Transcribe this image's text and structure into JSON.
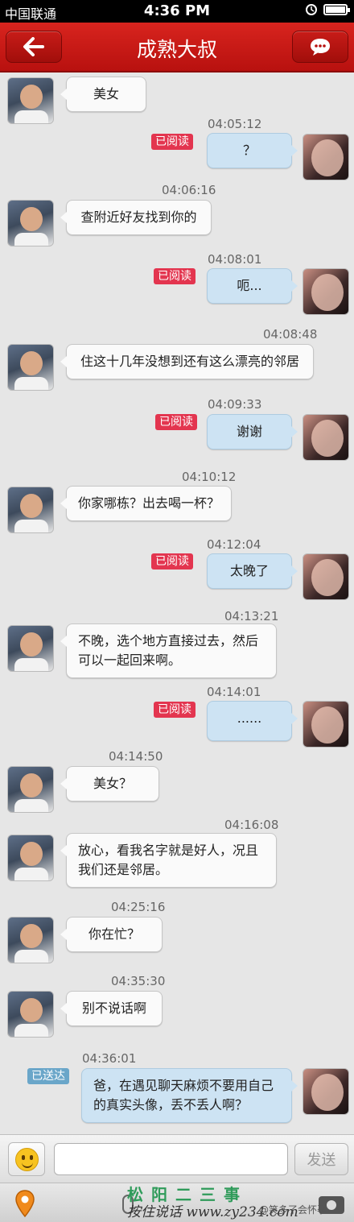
{
  "status_bar": {
    "carrier": "中国联通",
    "time": "4:36 PM"
  },
  "header": {
    "title": "成熟大叔",
    "back_icon": "back-arrow-icon",
    "chat_icon": "speech-bubble-icon"
  },
  "messages": [
    {
      "side": "in",
      "text": "美女"
    },
    {
      "side": "out",
      "time": "04:05:12",
      "status": "已阅读",
      "text": "？"
    },
    {
      "side": "in",
      "time": "04:06:16",
      "text": "查附近好友找到你的"
    },
    {
      "side": "out",
      "time": "04:08:01",
      "status": "已阅读",
      "text": "呃..."
    },
    {
      "side": "in",
      "time": "04:08:48",
      "text": "住这十几年没想到还有这么漂亮的邻居"
    },
    {
      "side": "out",
      "time": "04:09:33",
      "status": "已阅读",
      "text": "谢谢"
    },
    {
      "side": "in",
      "time": "04:10:12",
      "text": "你家哪栋？出去喝一杯？"
    },
    {
      "side": "out",
      "time": "04:12:04",
      "status": "已阅读",
      "text": "太晚了"
    },
    {
      "side": "in",
      "time": "04:13:21",
      "text": "不晚，选个地方直接过去，然后可以一起回来啊。"
    },
    {
      "side": "out",
      "time": "04:14:01",
      "status": "已阅读",
      "text": "......"
    },
    {
      "side": "in",
      "time": "04:14:50",
      "text": "美女？"
    },
    {
      "side": "in",
      "time": "04:16:08",
      "text": "放心，看我名字就是好人，况且我们还是邻居。"
    },
    {
      "side": "in",
      "time": "04:25:16",
      "text": "你在忙？"
    },
    {
      "side": "in",
      "time": "04:35:30",
      "text": "别不说话啊"
    },
    {
      "side": "out",
      "time": "04:36:01",
      "status": "已送达",
      "text": "爸，在遇见聊天麻烦不要用自己的真实头像，丢不丢人啊？"
    }
  ],
  "input_bar": {
    "emoji_icon": "smiley-icon",
    "placeholder": "",
    "send_label": "发送"
  },
  "toolbar": {
    "location_icon": "location-pin-icon",
    "mic_icon": "microphone-icon",
    "camera_icon": "camera-icon"
  },
  "watermark": {
    "line1": "松阳二三事",
    "line2": "按住说话 www.zy234.com",
    "line3": "@笑多了会怀孕"
  },
  "colors": {
    "header_red": "#c81a16",
    "read_badge": "#e3354f",
    "sent_badge": "#6aa6c9",
    "outgoing_bubble": "#cde3f3"
  }
}
